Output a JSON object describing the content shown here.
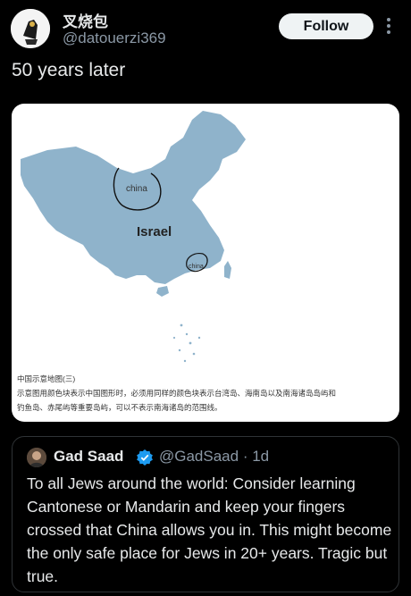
{
  "author": {
    "display_name": "叉烧包",
    "handle": "@datouerzi369",
    "follow_label": "Follow"
  },
  "tweet": {
    "text": "50 years later"
  },
  "map": {
    "label_china_large": "china",
    "label_israel": "Israel",
    "label_china_small": "china",
    "caption_line1": "中国示意地图(三)",
    "caption_line2": "示意图用颜色块表示中国图形时，必须用同样的颜色块表示台湾岛、海南岛以及南海诸岛岛屿和",
    "caption_line3": "钓鱼岛、赤尾屿等重要岛屿，可以不表示南海诸岛的范围线。",
    "land_color": "#8fb3cb"
  },
  "quoted": {
    "display_name": "Gad Saad",
    "handle": "@GadSaad · 1d",
    "text": "To all Jews around the world:  Consider learning Cantonese or Mandarin and keep your fingers crossed that China allows you in.  This might become the only safe place for Jews in 20+ years.  Tragic but true."
  },
  "colors": {
    "background": "#000000",
    "text_primary": "#e7e9ea",
    "text_secondary": "#8b98a5",
    "verified": "#1d9bf0"
  }
}
